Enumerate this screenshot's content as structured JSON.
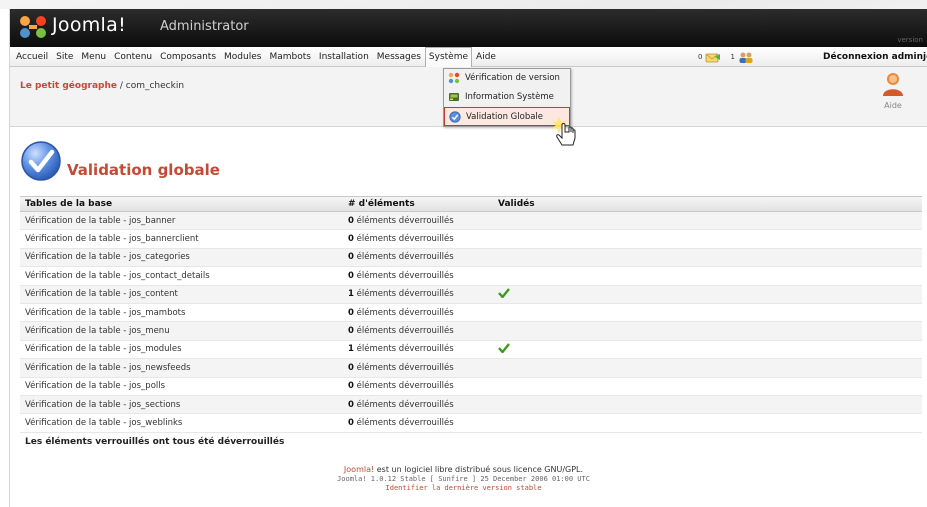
{
  "header": {
    "logo_main": "Joomla!",
    "logo_sub": "Administrator",
    "version_tag": "version"
  },
  "menu": {
    "items": [
      "Accueil",
      "Site",
      "Menu",
      "Contenu",
      "Composants",
      "Modules",
      "Mambots",
      "Installation",
      "Messages",
      "Système",
      "Aide"
    ],
    "active": "Système",
    "messages_count": "0",
    "users_count": "1",
    "logout": "Déconnexion adminjdo"
  },
  "breadcrumb": {
    "site": "Le petit géographe",
    "separator": " / ",
    "component": "com_checkin"
  },
  "toolbar": {
    "help_label": "Aide"
  },
  "dropdown": {
    "items": [
      {
        "label": "Vérification de version",
        "icon": "joomla-icon"
      },
      {
        "label": "Information Système",
        "icon": "system-info-icon"
      },
      {
        "label": "Validation Globale",
        "icon": "global-checkin-icon"
      }
    ],
    "highlighted_index": 2
  },
  "page": {
    "title": "Validation globale"
  },
  "table": {
    "headers": [
      "Tables de la base",
      "# d'éléments",
      "Validés"
    ],
    "rows": [
      {
        "table": "Vérification de la table - jos_banner",
        "count": "0",
        "count_text": " éléments déverrouillés",
        "checked": false
      },
      {
        "table": "Vérification de la table - jos_bannerclient",
        "count": "0",
        "count_text": " éléments déverrouillés",
        "checked": false
      },
      {
        "table": "Vérification de la table - jos_categories",
        "count": "0",
        "count_text": " éléments déverrouillés",
        "checked": false
      },
      {
        "table": "Vérification de la table - jos_contact_details",
        "count": "0",
        "count_text": " éléments déverrouillés",
        "checked": false
      },
      {
        "table": "Vérification de la table - jos_content",
        "count": "1",
        "count_text": " éléments déverrouillés",
        "checked": true
      },
      {
        "table": "Vérification de la table - jos_mambots",
        "count": "0",
        "count_text": " éléments déverrouillés",
        "checked": false
      },
      {
        "table": "Vérification de la table - jos_menu",
        "count": "0",
        "count_text": " éléments déverrouillés",
        "checked": false
      },
      {
        "table": "Vérification de la table - jos_modules",
        "count": "1",
        "count_text": " éléments déverrouillés",
        "checked": true
      },
      {
        "table": "Vérification de la table - jos_newsfeeds",
        "count": "0",
        "count_text": " éléments déverrouillés",
        "checked": false
      },
      {
        "table": "Vérification de la table - jos_polls",
        "count": "0",
        "count_text": " éléments déverrouillés",
        "checked": false
      },
      {
        "table": "Vérification de la table - jos_sections",
        "count": "0",
        "count_text": " éléments déverrouillés",
        "checked": false
      },
      {
        "table": "Vérification de la table - jos_weblinks",
        "count": "0",
        "count_text": " éléments déverrouillés",
        "checked": false
      }
    ],
    "footer": "Les éléments verrouillés ont tous été déverrouillés"
  },
  "footer": {
    "joomla_link": "Joomla!",
    "line1_rest": " est un logiciel libre distribué sous licence GNU/GPL.",
    "line2": "Joomla! 1.0.12 Stable [ Sunfire ] 25 December 2006 01:00 UTC",
    "line3": "Identifier la dernière version stable"
  },
  "colors": {
    "accent": "#c64934",
    "header_bg": "#111111",
    "check_green": "#3c9a1c"
  }
}
